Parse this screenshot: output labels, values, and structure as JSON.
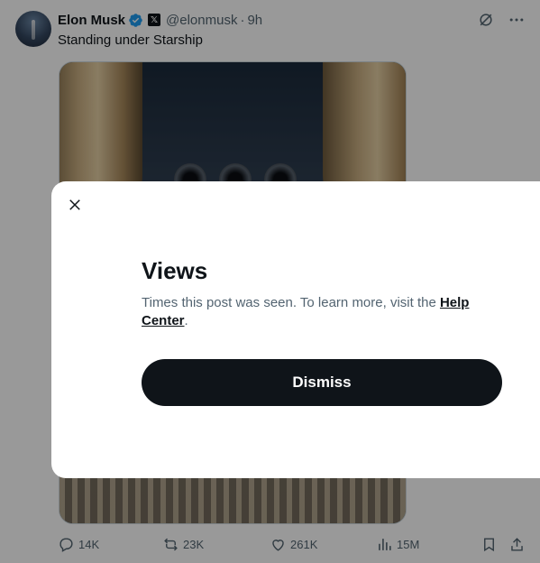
{
  "tweet": {
    "author_name": "Elon Musk",
    "handle": "@elonmusk",
    "separator": "·",
    "time": "9h",
    "text": "Standing under Starship",
    "icons": {
      "verified": "verified-badge-icon",
      "affiliation": "x-logo-icon",
      "grok": "grok-icon",
      "more": "more-icon"
    },
    "affiliation_glyph": "𝕏",
    "actions": {
      "replies": "14K",
      "reposts": "23K",
      "likes": "261K",
      "views": "15M"
    }
  },
  "modal": {
    "title": "Views",
    "description_prefix": "Times this post was seen. To learn more, visit the ",
    "help_link": "Help Center",
    "description_suffix": ".",
    "dismiss_label": "Dismiss"
  },
  "colors": {
    "primary_text": "#0f1419",
    "secondary_text": "#536471",
    "verified": "#1d9bf0",
    "overlay": "rgba(0,0,0,0.40)"
  }
}
